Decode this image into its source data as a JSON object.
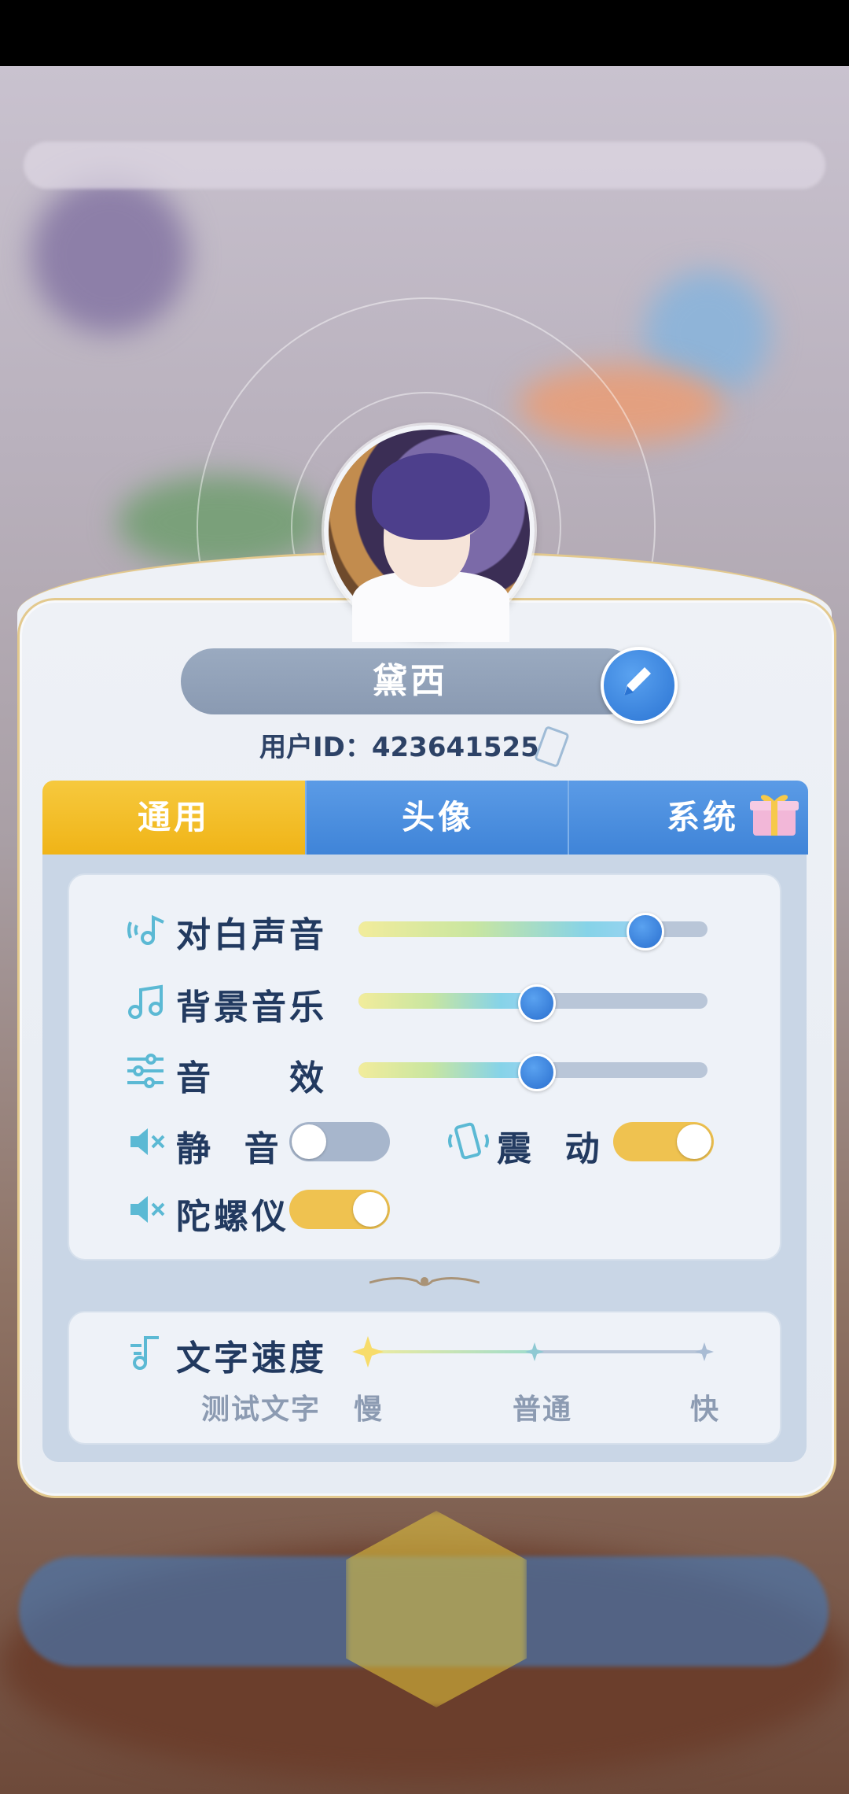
{
  "profile": {
    "name": "黛西",
    "user_id_label": "用户ID：423641525"
  },
  "tabs": [
    {
      "label": "通用",
      "active": true
    },
    {
      "label": "头像",
      "active": false
    },
    {
      "label": "系统",
      "active": false
    }
  ],
  "audio": {
    "dialogue": {
      "label": "对白声音",
      "level": 0.82,
      "icon": "dialogue-voice-icon"
    },
    "bgm": {
      "label": "背景音乐",
      "level": 0.51,
      "icon": "music-note-icon"
    },
    "sfx": {
      "label": "音　　效",
      "level": 0.51,
      "icon": "sliders-icon"
    }
  },
  "toggles": {
    "mute": {
      "label": "静  音",
      "on": false,
      "icon": "speaker-mute-icon"
    },
    "vibration": {
      "label": "震  动",
      "on": true,
      "icon": "vibration-icon"
    },
    "gyroscope": {
      "label": "陀螺仪",
      "on": true,
      "icon": "speaker-mute-icon"
    }
  },
  "text_speed": {
    "label": "文字速度",
    "sample": "测试文字",
    "options": [
      "慢",
      "普通",
      "快"
    ],
    "selected": "慢",
    "icon": "text-speed-icon"
  },
  "colors": {
    "tab_active": "#f3be28",
    "tab_inactive": "#4a8de0",
    "text_dark": "#223a60",
    "accent_blue": "#2f78d6",
    "toggle_on": "#efc250",
    "toggle_off": "#a7b6cc"
  }
}
